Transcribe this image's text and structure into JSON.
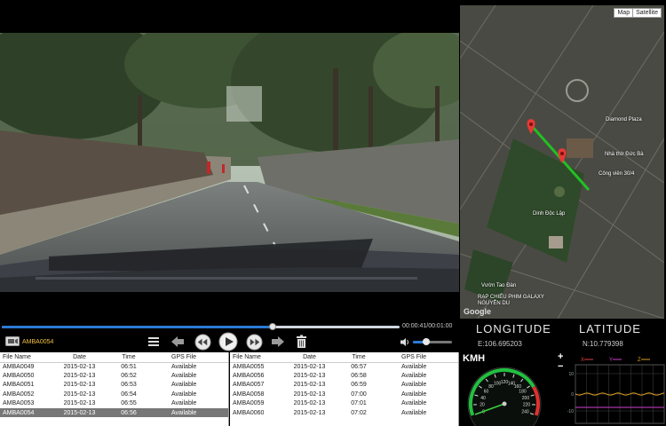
{
  "player": {
    "current_file": "AMBA0054",
    "time_display": "00:00:41/00:01:00",
    "progress": 0.68,
    "volume": 0.35
  },
  "map": {
    "toggle": [
      "Map",
      "Satellite"
    ],
    "labels": [
      "Diamond Plaza",
      "Nhà thờ Đức Bà",
      "Công viên 30/4",
      "Dinh Độc Lập",
      "Vườn Tao Đàn",
      "RẠP CHIẾU PHIM GALAXY NGUYỄN DU",
      "Google"
    ],
    "route_color": "#22c022",
    "marker_color": "#e53935"
  },
  "coords": {
    "longitude_label": "LONGITUDE",
    "latitude_label": "LATITUDE",
    "longitude_value": "E:106.695203",
    "latitude_value": "N:10.779398"
  },
  "speed": {
    "unit": "KMH",
    "max": 240,
    "value": 0,
    "ticks": [
      "0",
      "20",
      "40",
      "60",
      "80",
      "100",
      "120",
      "140",
      "160",
      "180",
      "200",
      "220",
      "240"
    ]
  },
  "sensor": {
    "zoom_in": "+",
    "zoom_out": "−",
    "axes": [
      "X",
      "Y",
      "Z"
    ],
    "y_ticks": [
      "10",
      "0",
      "-10"
    ],
    "colors": {
      "x": "#e04040",
      "y": "#d040d0",
      "z": "#e0a020"
    }
  },
  "tables": {
    "headers": [
      "File Name",
      "Date",
      "Time",
      "GPS File"
    ],
    "left_rows": [
      [
        "AMBA0049",
        "2015-02-13",
        "06:51",
        "Available"
      ],
      [
        "AMBA0050",
        "2015-02-13",
        "06:52",
        "Available"
      ],
      [
        "AMBA0051",
        "2015-02-13",
        "06:53",
        "Available"
      ],
      [
        "AMBA0052",
        "2015-02-13",
        "06:54",
        "Available"
      ],
      [
        "AMBA0053",
        "2015-02-13",
        "06:55",
        "Available"
      ],
      [
        "AMBA0054",
        "2015-02-13",
        "06:56",
        "Available"
      ]
    ],
    "right_rows": [
      [
        "AMBA0055",
        "2015-02-13",
        "06:57",
        "Available"
      ],
      [
        "AMBA0056",
        "2015-02-13",
        "06:58",
        "Available"
      ],
      [
        "AMBA0057",
        "2015-02-13",
        "06:59",
        "Available"
      ],
      [
        "AMBA0058",
        "2015-02-13",
        "07:00",
        "Available"
      ],
      [
        "AMBA0059",
        "2015-02-13",
        "07:01",
        "Available"
      ],
      [
        "AMBA0060",
        "2015-02-13",
        "07:02",
        "Available"
      ]
    ],
    "selected_file": "AMBA0054"
  }
}
